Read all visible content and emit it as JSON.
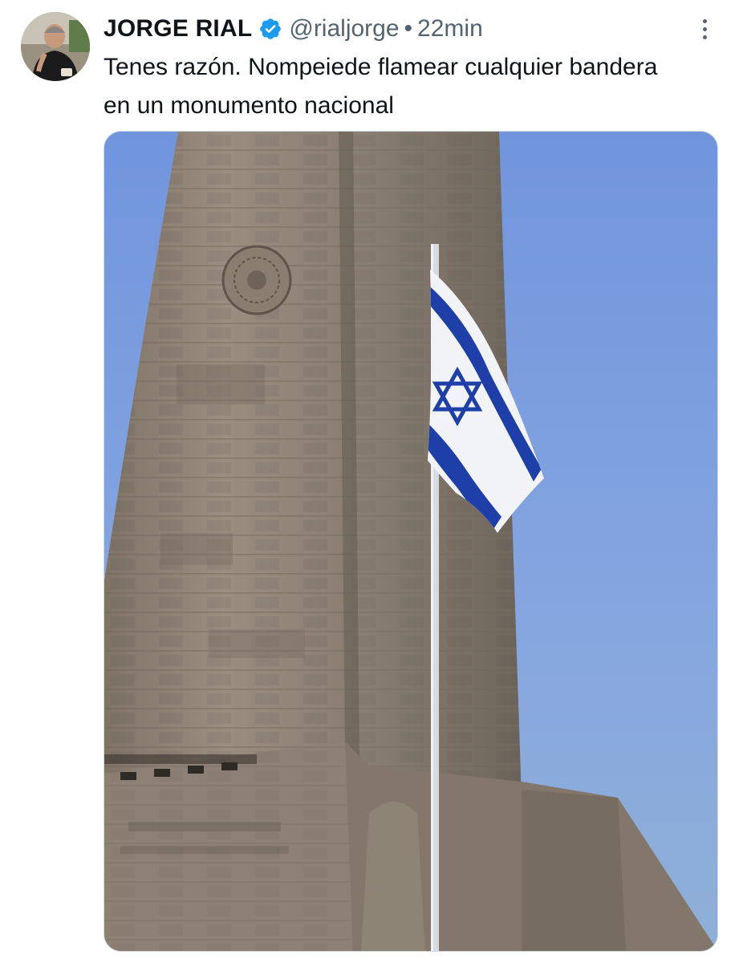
{
  "tweet": {
    "author": {
      "display_name": "JORGE RIAL",
      "handle": "@rialjorge",
      "verified": true,
      "avatar_icon": "profile-photo"
    },
    "separator": "•",
    "timestamp": "22min",
    "text": "Tenes razón. Nompeiede flamear cualquier bandera en un monumento nacional",
    "menu_icon": "more-options-icon",
    "media": {
      "kind": "photo",
      "icon": "photo-monument-flag"
    }
  },
  "colors": {
    "text_primary": "#0f1419",
    "text_secondary": "#536471",
    "verified_blue": "#1d9bf0",
    "sky": "#7c9bd9",
    "flag_blue": "#1f3fa8"
  }
}
